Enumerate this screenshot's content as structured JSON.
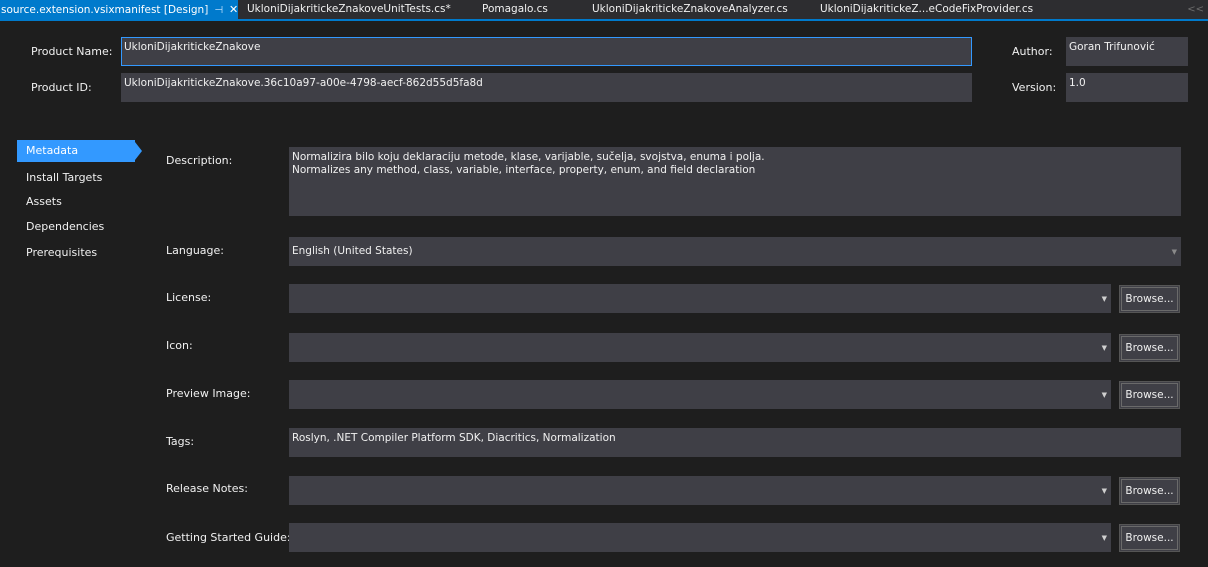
{
  "tabs": [
    {
      "label": "source.extension.vsixmanifest [Design]",
      "active": true,
      "pin_icon": "pin-icon",
      "close_icon": "close-icon"
    },
    {
      "label": "UkloniDijakritickeZnakoveUnitTests.cs*"
    },
    {
      "label": "Pomagalo.cs"
    },
    {
      "label": "UkloniDijakritickeZnakoveAnalyzer.cs"
    },
    {
      "label": "UkloniDijakritickeZ...eCodeFixProvider.cs"
    }
  ],
  "tab_overflow": "<<",
  "header": {
    "product_name_label": "Product Name:",
    "product_name_value": "UkloniDijakritickeZnakove",
    "product_id_label": "Product ID:",
    "product_id_value": "UkloniDijakritickeZnakove.36c10a97-a00e-4798-aecf-862d55d5fa8d",
    "author_label": "Author:",
    "author_value": "Goran Trifunović",
    "version_label": "Version:",
    "version_value": "1.0"
  },
  "nav": {
    "items": [
      "Metadata",
      "Install Targets",
      "Assets",
      "Dependencies",
      "Prerequisites"
    ],
    "active": "Metadata"
  },
  "metadata": {
    "description_label": "Description:",
    "description_lines": [
      "Normalizira bilo koju deklaraciju metode, klase, varijable, sučelja, svojstva, enuma i polja.",
      "Normalizes any method, class, variable, interface, property, enum, and field declaration"
    ],
    "language_label": "Language:",
    "language_value": "English (United States)",
    "license_label": "License:",
    "license_value": "",
    "icon_label": "Icon:",
    "icon_value": "",
    "preview_image_label": "Preview Image:",
    "preview_image_value": "",
    "tags_label": "Tags:",
    "tags_value": "Roslyn, .NET Compiler Platform SDK, Diacritics, Normalization",
    "release_notes_label": "Release Notes:",
    "release_notes_value": "",
    "getting_started_label": "Getting Started Guide:",
    "getting_started_value": "",
    "browse_label": "Browse..."
  },
  "colors": {
    "background": "#1e1e1e",
    "field": "#3f3f46",
    "accent": "#007acc",
    "nav_active": "#3399ff",
    "text": "#f1f1f1"
  }
}
